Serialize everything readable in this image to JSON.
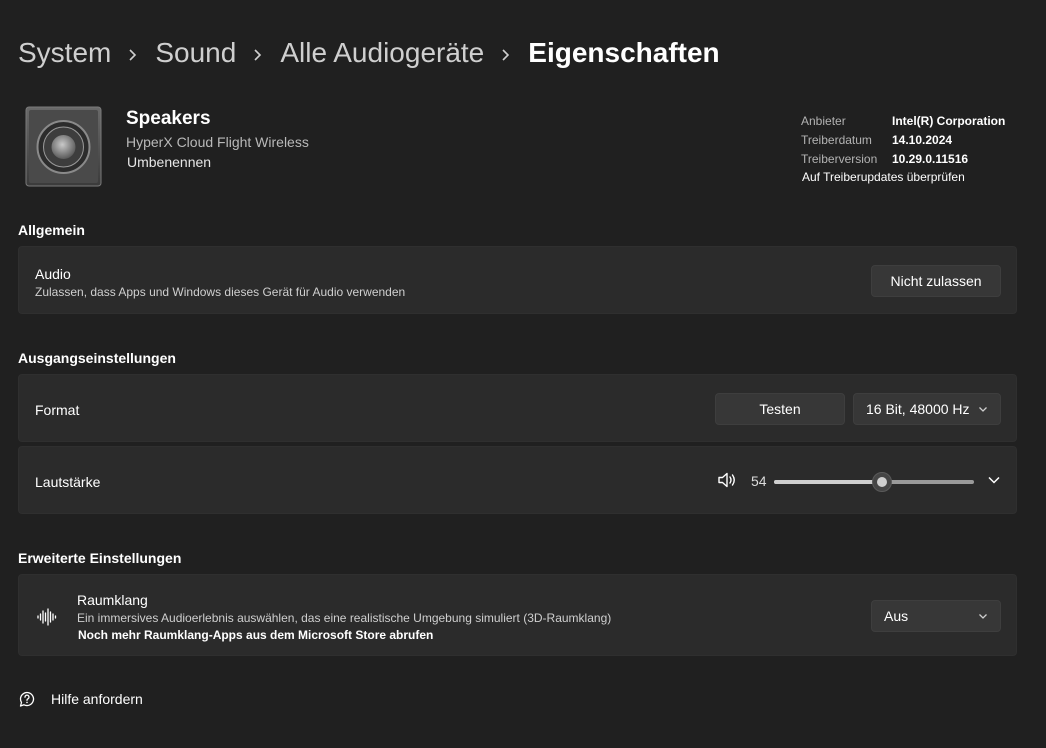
{
  "breadcrumb": {
    "items": [
      "System",
      "Sound",
      "Alle Audiogeräte",
      "Eigenschaften"
    ]
  },
  "device": {
    "name": "Speakers",
    "model": "HyperX Cloud Flight Wireless",
    "rename_label": "Umbenennen",
    "icon": "speaker-device-icon"
  },
  "driver": {
    "provider_label": "Anbieter",
    "provider_value": "Intel(R) Corporation",
    "date_label": "Treiberdatum",
    "date_value": "14.10.2024",
    "version_label": "Treiberversion",
    "version_value": "10.29.0.11516",
    "update_link": "Auf Treiberupdates überprüfen"
  },
  "general": {
    "section_title": "Allgemein",
    "audio": {
      "title": "Audio",
      "description": "Zulassen, dass Apps und Windows dieses Gerät für Audio verwenden",
      "button_label": "Nicht zulassen"
    }
  },
  "output": {
    "section_title": "Ausgangseinstellungen",
    "format": {
      "title": "Format",
      "test_label": "Testen",
      "selected": "16 Bit, 48000 Hz"
    },
    "volume": {
      "title": "Lautstärke",
      "value": 54,
      "value_text": "54",
      "icon": "speaker-volume-icon"
    }
  },
  "advanced": {
    "section_title": "Erweiterte Einstellungen",
    "spatial": {
      "title": "Raumklang",
      "description": "Ein immersives Audioerlebnis auswählen, das eine realistische Umgebung simuliert (3D-Raumklang)",
      "store_link": "Noch mehr Raumklang-Apps aus dem Microsoft Store abrufen",
      "selected": "Aus",
      "icon": "spatial-sound-icon"
    }
  },
  "help": {
    "label": "Hilfe anfordern",
    "icon": "help-chat-icon"
  },
  "colors": {
    "background": "#202020",
    "card": "#2b2b2b",
    "button": "#373737"
  }
}
